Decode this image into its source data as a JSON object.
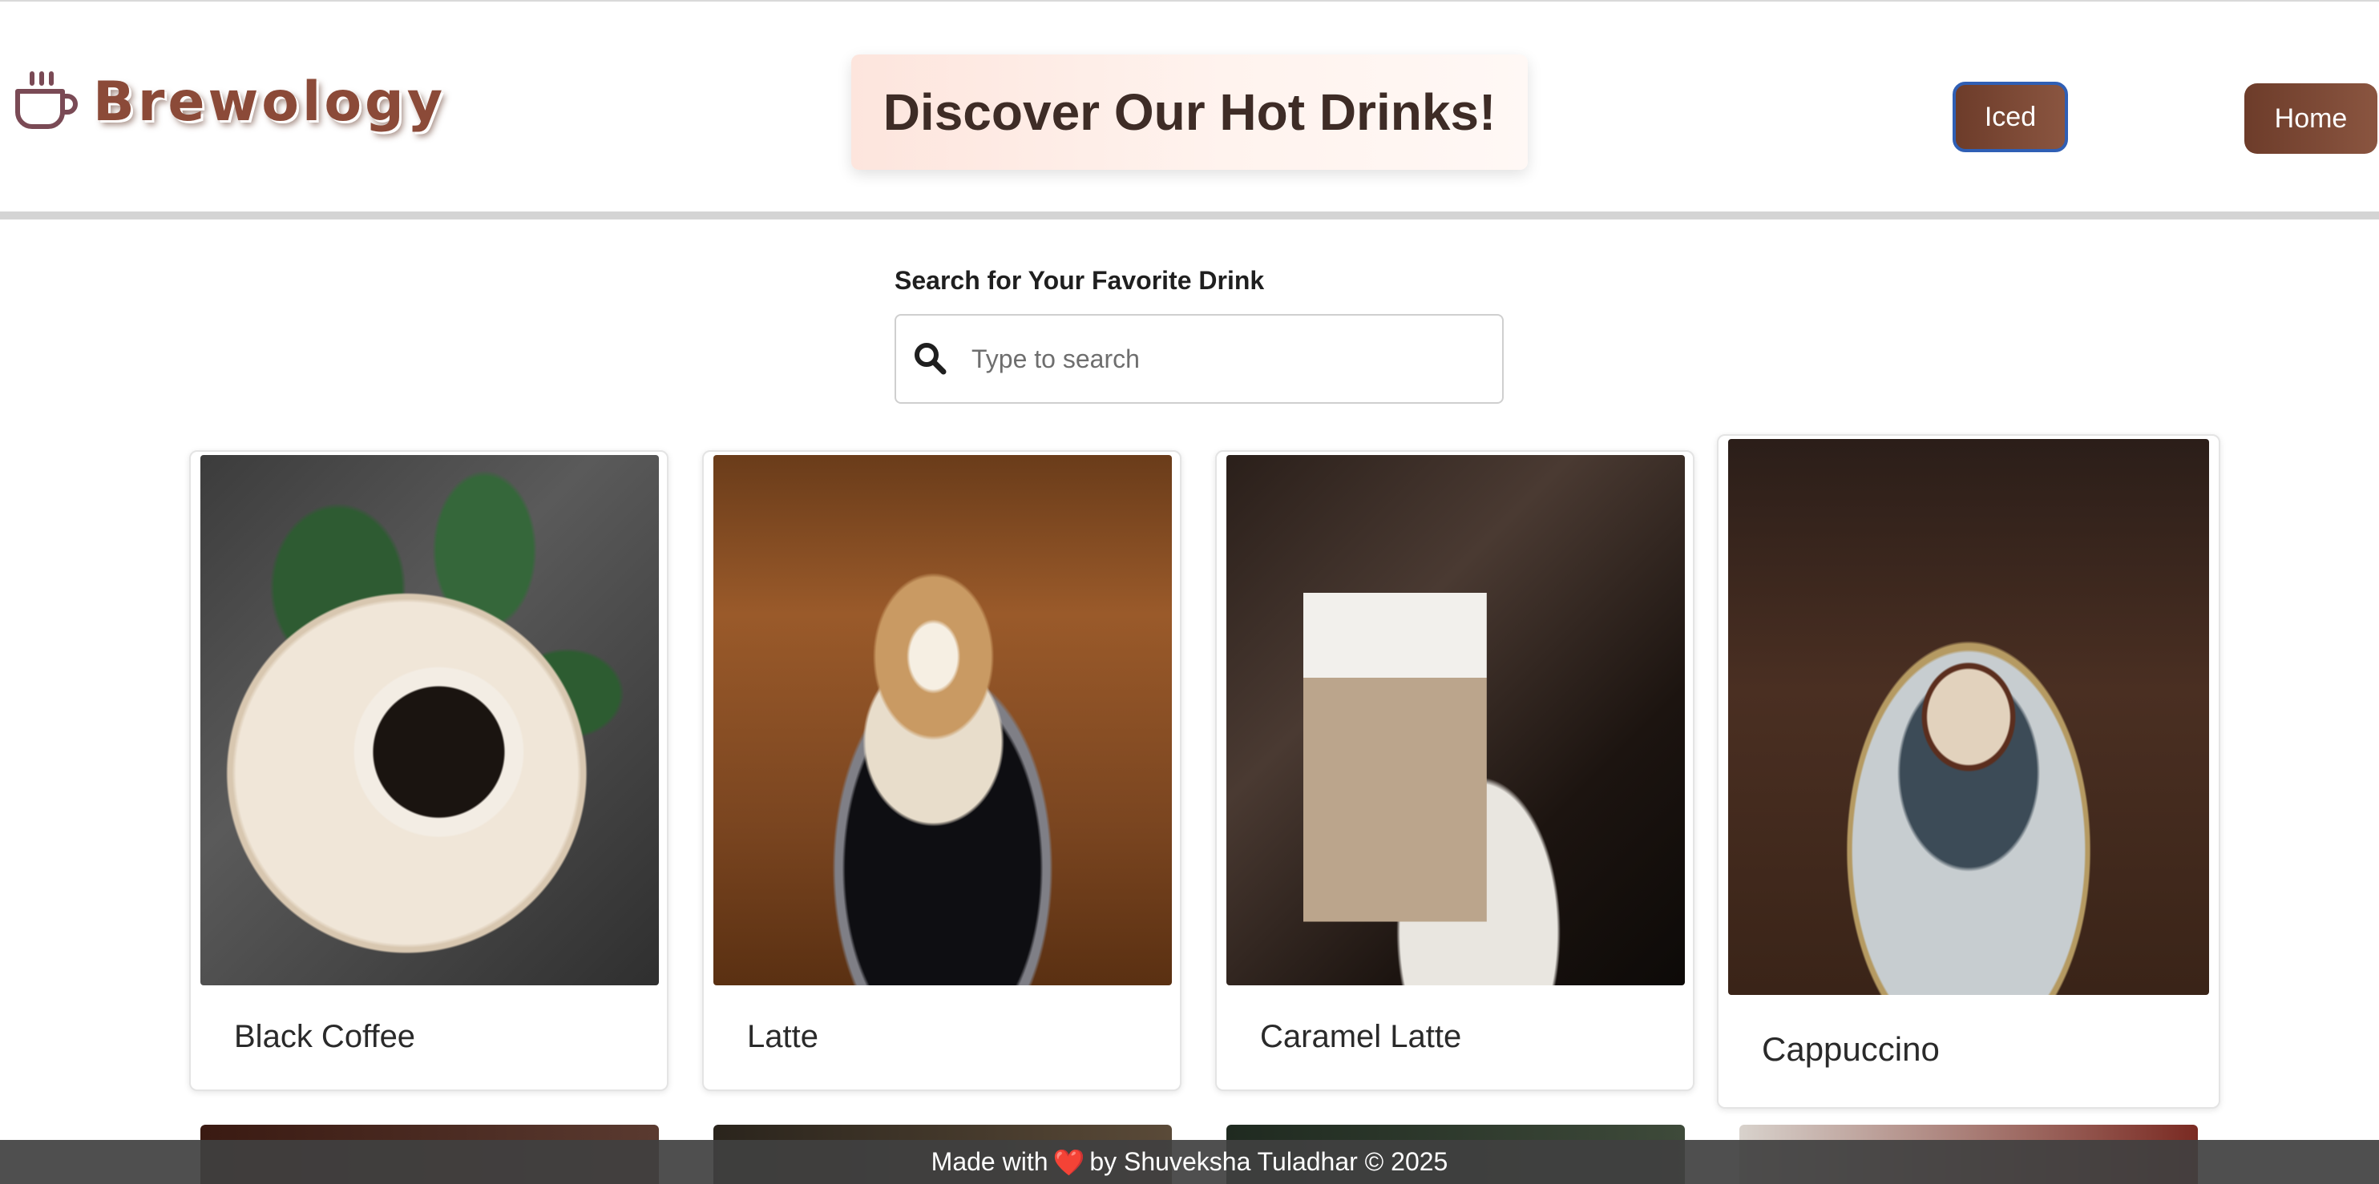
{
  "header": {
    "logo_text": "Brewology",
    "banner_title": "Discover Our Hot Drinks!",
    "nav": {
      "iced_label": "Iced",
      "home_label": "Home"
    }
  },
  "search": {
    "label": "Search for Your Favorite Drink",
    "placeholder": "Type to search",
    "value": ""
  },
  "drinks": [
    {
      "name": "Black Coffee"
    },
    {
      "name": "Latte"
    },
    {
      "name": "Caramel Latte"
    },
    {
      "name": "Cappuccino"
    }
  ],
  "footer": {
    "prefix": "Made with",
    "suffix": "by Shuveksha Tuladhar © 2025"
  },
  "colors": {
    "brand_brown": "#8b4a38",
    "button_brown": "#6d3c2a",
    "focus_blue": "#2f5fb5",
    "footer_bg": "#404040"
  },
  "icons": [
    "coffee-cup-icon",
    "search-icon",
    "heart-icon"
  ]
}
